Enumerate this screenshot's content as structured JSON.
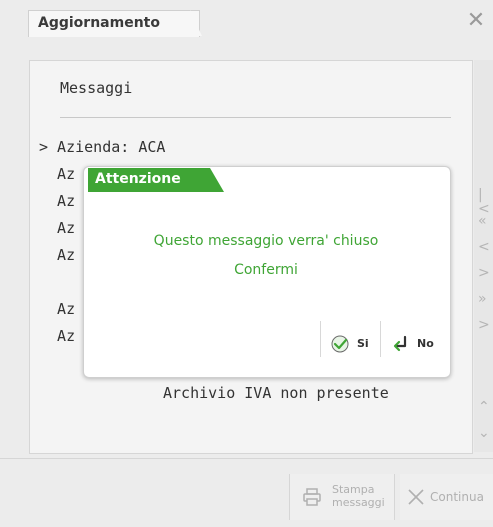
{
  "window": {
    "tab_title": "Aggiornamento"
  },
  "panel": {
    "heading": "Messaggi",
    "lines": [
      "> Azienda: ACA",
      "  Az",
      "  Az",
      "  Az",
      "  Az",
      "  Az",
      "  Az"
    ],
    "footer_line": "Archivio IVA non presente"
  },
  "dialog": {
    "title": "Attenzione",
    "message_line1": "Questo messaggio verra' chiuso",
    "message_line2": "Confermi",
    "yes_label": "Si",
    "no_label": "No",
    "accent_color": "#3fa535"
  },
  "bottom": {
    "print_label_line1": "Stampa",
    "print_label_line2": "messaggi",
    "continue_label": "Continua"
  }
}
